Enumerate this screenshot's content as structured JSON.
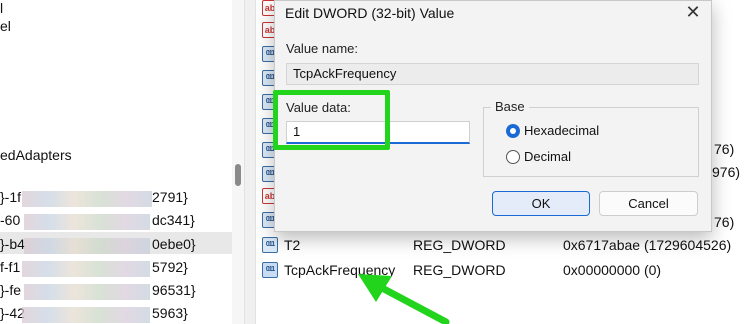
{
  "tree": {
    "adapters_label": "edAdapters",
    "entries": [
      {
        "prefix": "}-1f",
        "suffix": "2791}"
      },
      {
        "prefix": "-60",
        "suffix": "dc341}"
      },
      {
        "prefix": "}-b4",
        "suffix": "0ebe0}"
      },
      {
        "prefix": "f-f1",
        "suffix": "5792}"
      },
      {
        "prefix": "}-fe",
        "suffix": "96531}"
      },
      {
        "prefix": "}-42",
        "suffix": "5963}"
      }
    ]
  },
  "registry": {
    "partial_values": [
      "76)",
      "976)",
      "76)"
    ],
    "rows": [
      {
        "name": "T2",
        "type": "REG_DWORD",
        "data": "0x6717abae (1729604526)"
      },
      {
        "name": "TcpAckFrequency",
        "type": "REG_DWORD",
        "data": "0x00000000 (0)"
      }
    ]
  },
  "dialog": {
    "title": "Edit DWORD (32-bit) Value",
    "close_glyph": "✕",
    "value_name_label": "Value name:",
    "value_name": "TcpAckFrequency",
    "value_data_label": "Value data:",
    "value_data": "1",
    "base_label": "Base",
    "base_options": [
      "Hexadecimal",
      "Decimal"
    ],
    "base_selected": "Hexadecimal",
    "ok_label": "OK",
    "cancel_label": "Cancel"
  },
  "annotation": {
    "highlight_color": "#22d41c",
    "arrow_color": "#22d41c"
  }
}
